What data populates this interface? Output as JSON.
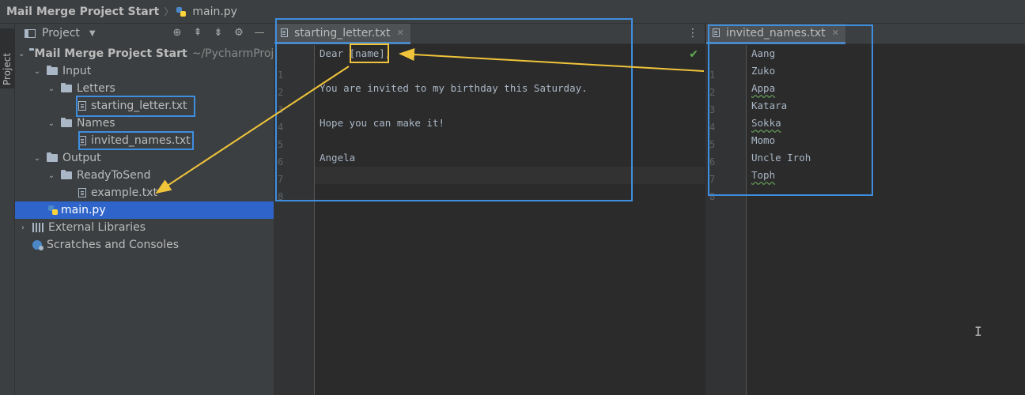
{
  "breadcrumb": {
    "project": "Mail Merge Project Start",
    "file": "main.py"
  },
  "side_strip": {
    "tab_label": "Project"
  },
  "project_panel": {
    "title": "Project",
    "tree": [
      {
        "label": "Mail Merge Project Start",
        "hint": "~/PycharmProj"
      },
      {
        "label": "Input"
      },
      {
        "label": "Letters"
      },
      {
        "label": "starting_letter.txt"
      },
      {
        "label": "Names"
      },
      {
        "label": "invited_names.txt"
      },
      {
        "label": "Output"
      },
      {
        "label": "ReadyToSend"
      },
      {
        "label": "example.txt"
      },
      {
        "label": "main.py"
      },
      {
        "label": "External Libraries"
      },
      {
        "label": "Scratches and Consoles"
      }
    ]
  },
  "editor_letter": {
    "tab": "starting_letter.txt",
    "line_numbers": [
      "1",
      "2",
      "3",
      "4",
      "5",
      "6",
      "7",
      "8"
    ],
    "lines": [
      "Dear [name],",
      "",
      "You are invited to my birthday this Saturday.",
      "",
      "Hope you can make it!",
      "",
      "Angela",
      ""
    ]
  },
  "editor_names": {
    "tab": "invited_names.txt",
    "line_numbers": [
      "1",
      "2",
      "3",
      "4",
      "5",
      "6",
      "7",
      "8"
    ],
    "lines": [
      "Aang",
      "Zuko",
      "Appa",
      "Katara",
      "Sokka",
      "Momo",
      "Uncle Iroh",
      "Toph"
    ]
  },
  "colors": {
    "highlight_blue": "#3e8ee0",
    "annotation_yellow": "#f0c43a",
    "selection": "#2f65ca"
  }
}
